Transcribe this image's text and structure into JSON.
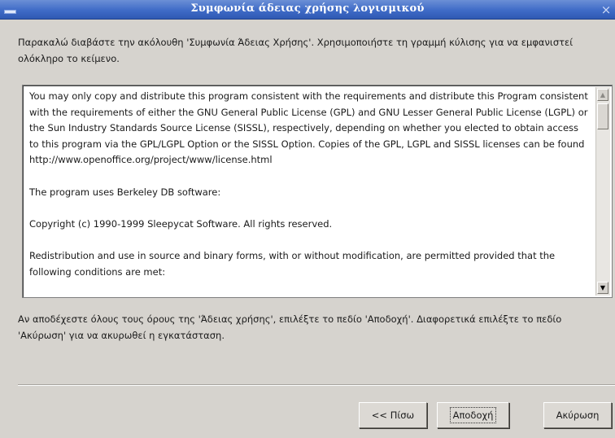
{
  "window": {
    "title": "Συμφωνία άδειας χρήσης λογισμικού",
    "close_glyph": "×"
  },
  "instruction_text": "Παρακαλώ διαβάστε την ακόλουθη 'Συμφωνία Άδειας Χρήσης'. Χρησιμοποιήστε τη γραμμή κύλισης για να εμφανιστεί ολόκληρο το κείμενο.",
  "license": {
    "paragraphs": [
      "You may only copy and distribute this program consistent with the requirements and distribute this Program consistent with the requirements of either the GNU General Public License (GPL) and GNU Lesser General Public License (LGPL) or the Sun Industry Standards Source License (SISSL), respectively, depending on whether you elected to obtain access to this program via the GPL/LGPL Option or the SISSL Option. Copies of the GPL, LGPL and SISSL licenses can be found http://www.openoffice.org/project/www/license.html",
      "The program uses Berkeley DB software:",
      "Copyright (c) 1990-1999 Sleepycat Software.  All rights reserved.",
      "Redistribution and use in source and binary forms, with or without modification, are permitted provided that the following conditions are met:"
    ]
  },
  "accept_note": "Αν αποδέχεστε όλους τους όρους της 'Άδειας χρήσης', επιλέξτε το πεδίο 'Αποδοχή'. Διαφορετικά επιλέξτε το πεδίο 'Ακύρωση' για να ακυρωθεί η εγκατάσταση.",
  "buttons": {
    "back": "<< Πίσω",
    "accept": "Αποδοχή",
    "cancel": "Ακύρωση"
  },
  "colors": {
    "titlebar": "#3f6bc7",
    "dialog_bg": "#d6d3ce",
    "text_bg": "#ffffff"
  },
  "icons": {
    "menu": "window-menu-icon",
    "close": "close-icon",
    "scroll_up": "arrow-up-icon",
    "scroll_down": "arrow-down-icon"
  }
}
